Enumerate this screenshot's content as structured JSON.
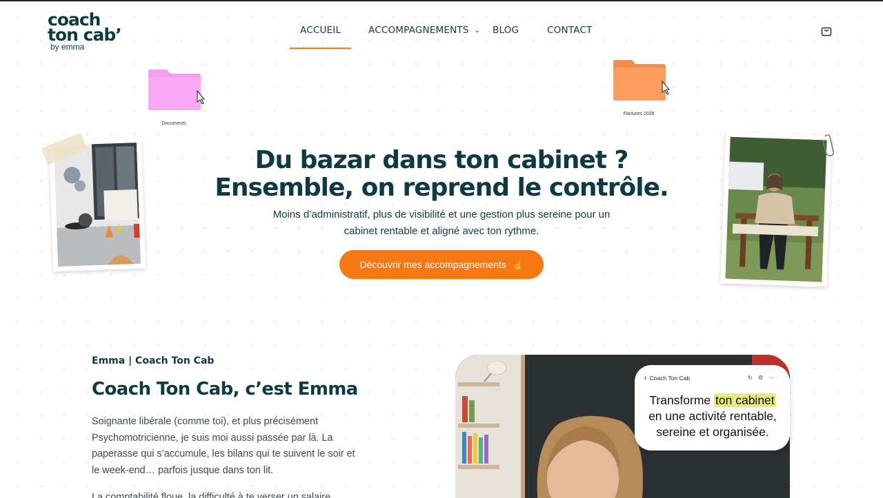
{
  "header": {
    "logo": {
      "line1": "coach",
      "line2": "ton cab’",
      "line3": "by emma"
    },
    "nav": [
      {
        "label": "ACCUEIL",
        "active": true
      },
      {
        "label": "ACCOMPAGNEMENTS",
        "has_dropdown": true
      },
      {
        "label": "BLOG"
      },
      {
        "label": "CONTACT"
      }
    ],
    "cart_icon": "shopping-bag-icon"
  },
  "decor": {
    "folder_left_label": "Documents",
    "folder_right_label": "Factures 2026",
    "folder_left_color": "#f59cf3",
    "folder_right_color": "#fd9e5e"
  },
  "hero": {
    "title_line1": "Du bazar dans ton cabinet ?",
    "title_line2": "Ensemble, on reprend le contrôle.",
    "subtitle_line1": "Moins d’administratif, plus de visibilité et une gestion plus sereine pour un",
    "subtitle_line2": "cabinet rentable et aligné avec ton rythme.",
    "cta_label": "Découvrir mes accompagnements",
    "cta_icon": "pointer-hand-icon"
  },
  "about": {
    "kicker": "Emma | Coach Ton Cab",
    "title": "Coach Ton Cab, c’est Emma",
    "p1_line1": "Soignante libérale (comme toi), et plus précisément",
    "p1_line2": "Psychomotricienne, je suis moi aussi passée par là. La",
    "p1_line3": "paperasse qui s’accumule, les bilans qui te suivent le soir et",
    "p1_line4": "le week-end… parfois jusque dans ton lit.",
    "p2_line1": "La comptabilité floue, la difficulté à te verser un salaire"
  },
  "bubble": {
    "header": "Coach Ton Cab",
    "text_before": "Transforme ",
    "text_highlight": "ton cabinet",
    "text_line2": "en une activité rentable,",
    "text_line3": "sereine et organisée."
  },
  "colors": {
    "accent": "#f77712",
    "primary": "#0d3a44"
  }
}
